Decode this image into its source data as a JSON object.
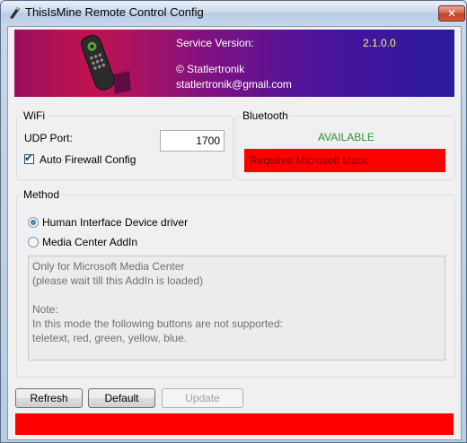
{
  "window": {
    "title": "ThisIsMine Remote Control Config",
    "close_symbol": "✕"
  },
  "banner": {
    "service_label": "Service Version:",
    "service_version": "2.1.0.0",
    "copyright": "© Statlertronik",
    "email": "statlertronik@gmail.com"
  },
  "wifi": {
    "title": "WiFi",
    "udp_label": "UDP Port:",
    "udp_value": "1700",
    "firewall_label": "Auto Firewall Config",
    "firewall_checked": true
  },
  "bluetooth": {
    "title": "Bluetooth",
    "status": "AVAILABLE",
    "message": "Requires Microsoft stack"
  },
  "method": {
    "title": "Method",
    "options": [
      {
        "label": "Human Interface Device driver",
        "selected": true
      },
      {
        "label": "Media Center AddIn",
        "selected": false
      }
    ],
    "info_text": "Only for Microsoft Media Center\n(please wait till this AddIn is loaded)\n\nNote:\nIn this mode the following buttons are not supported:\nteletext, red, green, yellow, blue."
  },
  "buttons": {
    "refresh": "Refresh",
    "default": "Default",
    "update": "Update"
  },
  "colors": {
    "status_bar": "#ff0000",
    "available": "#2f8f3a"
  }
}
